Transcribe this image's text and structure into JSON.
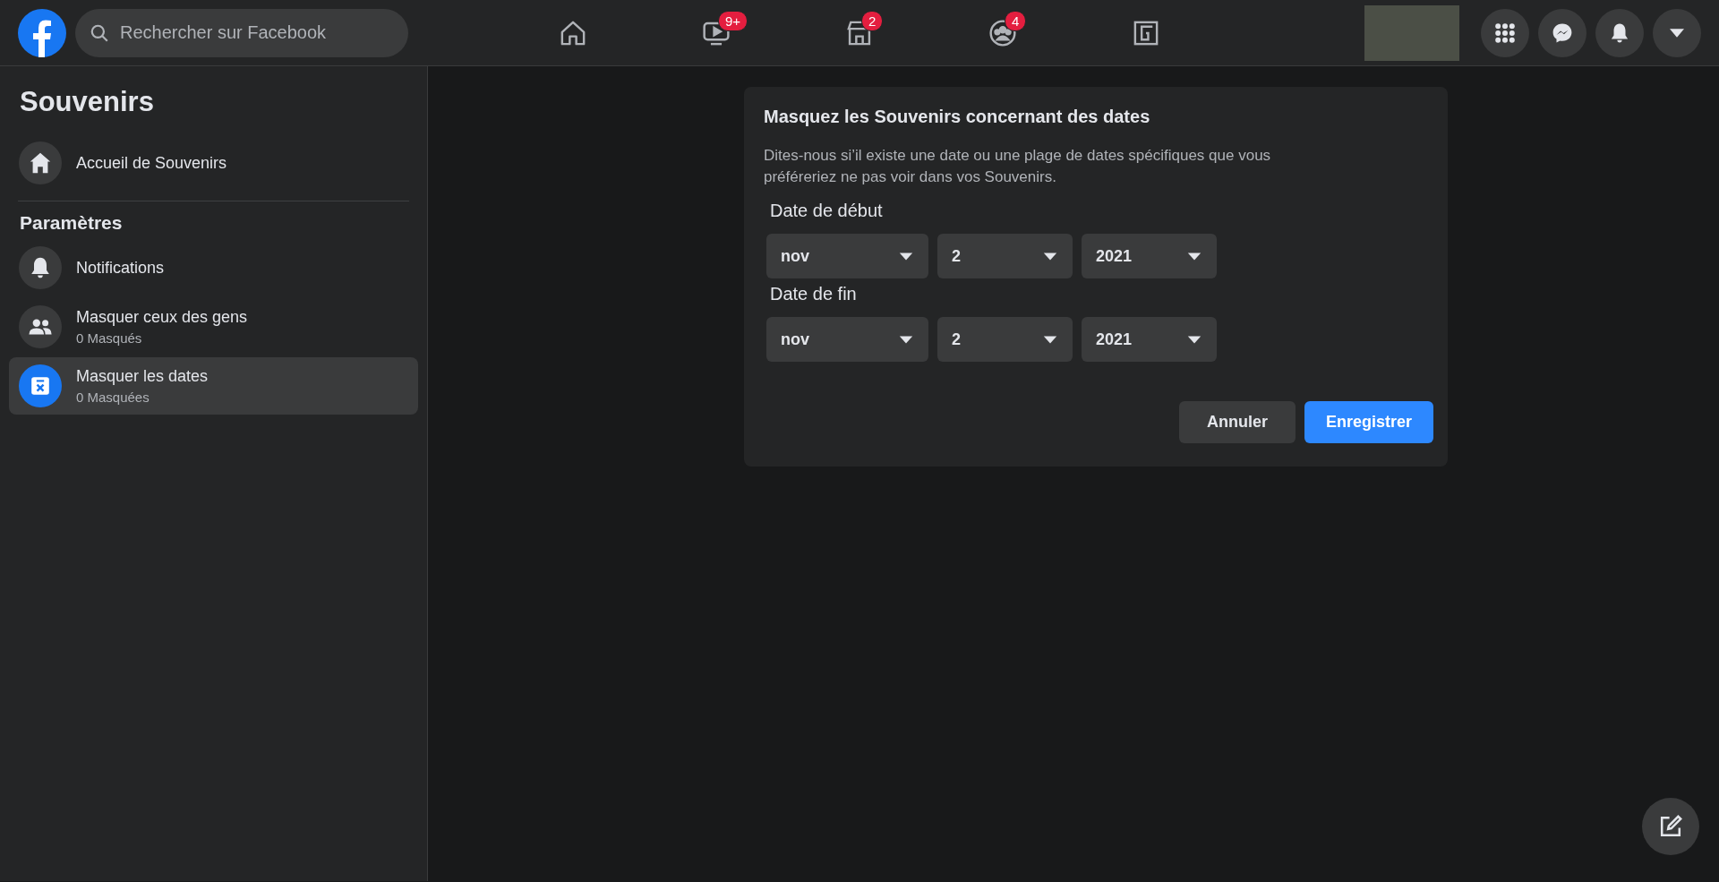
{
  "header": {
    "search": {
      "placeholder": "Rechercher sur Facebook"
    },
    "nav": [
      {
        "kind": "home",
        "selected": false
      },
      {
        "kind": "video",
        "badge": "9+",
        "selected": false
      },
      {
        "kind": "store",
        "badge": "2",
        "selected": false
      },
      {
        "kind": "groups",
        "badge": "4",
        "selected": false
      },
      {
        "kind": "gaming",
        "selected": false
      }
    ],
    "actions": [
      {
        "kind": "menu"
      },
      {
        "kind": "messenger"
      },
      {
        "kind": "bell"
      },
      {
        "kind": "caret"
      }
    ]
  },
  "sidebar": {
    "title": "Souvenirs",
    "home_item": {
      "label": "Accueil de Souvenirs",
      "selected": false
    },
    "section_title": "Paramètres",
    "items": [
      {
        "kind": "bell",
        "label": "Notifications",
        "selected": false
      },
      {
        "kind": "people",
        "label": "Masquer ceux des gens",
        "sublabel": "0 Masqués",
        "selected": false
      },
      {
        "kind": "calendar",
        "label": "Masquer les dates",
        "sublabel": "0 Masquées",
        "selected": true
      }
    ]
  },
  "dialog": {
    "title": "Masquez les Souvenirs concernant des dates",
    "description": "Dites-nous si’il existe une date ou une plage de dates spécifiques que vous préféreriez ne pas voir dans vos Souvenirs.",
    "ranges": [
      {
        "label": "Date de début",
        "month": "nov",
        "day": "2",
        "year": "2021"
      },
      {
        "label": "Date de fin",
        "month": "nov",
        "day": "2",
        "year": "2021"
      }
    ],
    "buttons": [
      {
        "kind": "secondary",
        "label": "Annuler"
      },
      {
        "kind": "primary",
        "label": "Enregistrer"
      }
    ]
  }
}
